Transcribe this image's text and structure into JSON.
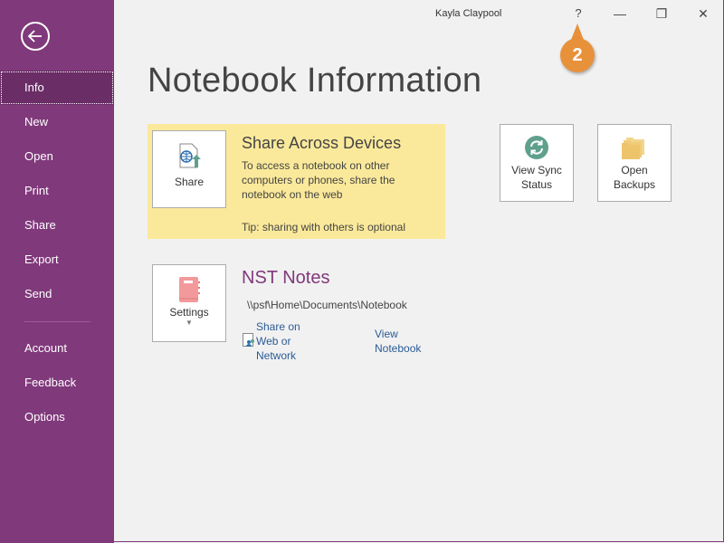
{
  "window": {
    "user_name": "Kayla Claypool",
    "help_label": "?",
    "minimize_label": "—",
    "restore_label": "❐",
    "close_label": "✕"
  },
  "callout": {
    "number": "2",
    "color": "#e8913b"
  },
  "sidebar": {
    "back_icon": "back-arrow-icon",
    "items": [
      {
        "label": "Info",
        "active": true
      },
      {
        "label": "New"
      },
      {
        "label": "Open"
      },
      {
        "label": "Print"
      },
      {
        "label": "Share"
      },
      {
        "label": "Export"
      },
      {
        "label": "Send"
      },
      {
        "label": "Account"
      },
      {
        "label": "Feedback"
      },
      {
        "label": "Options"
      }
    ]
  },
  "main": {
    "title": "Notebook Information",
    "share_panel": {
      "button_label": "Share",
      "title": "Share Across Devices",
      "description": "To access a notebook on other computers or phones, share the notebook on the web",
      "tip": "Tip: sharing with others is optional"
    },
    "sync_button": {
      "label_line1": "View Sync",
      "label_line2": "Status"
    },
    "backups_button": {
      "label_line1": "Open",
      "label_line2": "Backups"
    },
    "notebook": {
      "settings_label": "Settings",
      "name": "NST Notes",
      "path": "\\\\psf\\Home\\Documents\\Notebook",
      "share_link_line1": "Share on",
      "share_link_line2": "Web or",
      "share_link_line3": "Network",
      "view_link_line1": "View",
      "view_link_line2": "Notebook"
    }
  }
}
